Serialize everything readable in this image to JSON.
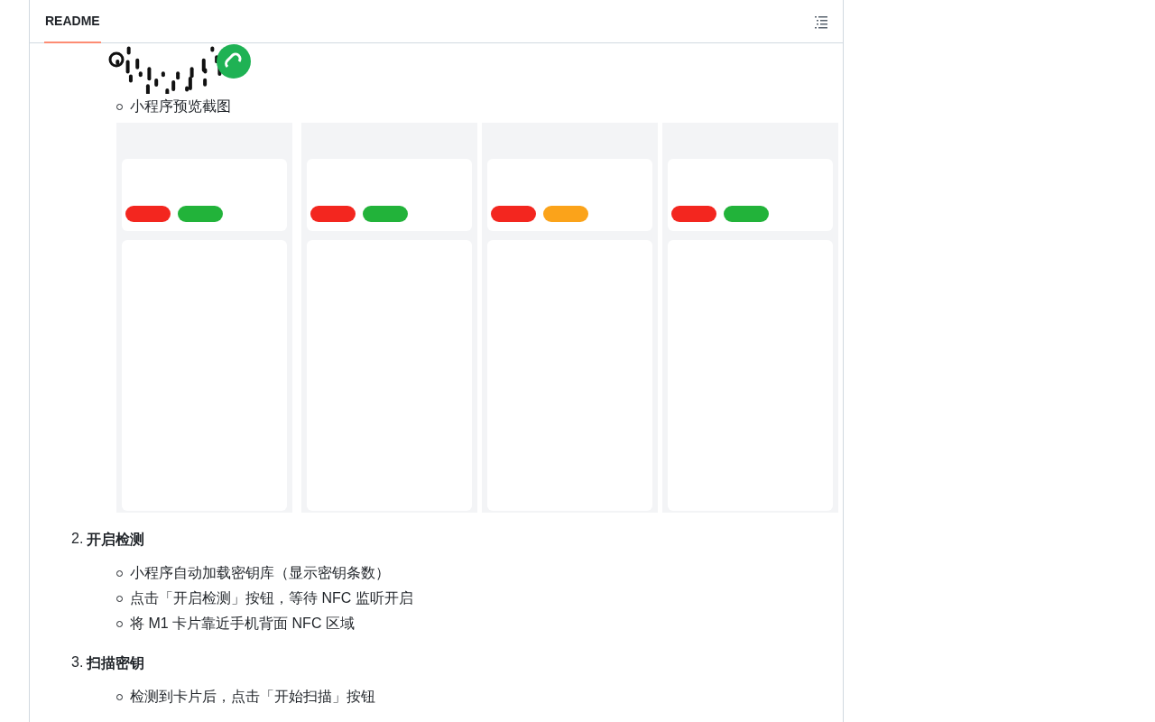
{
  "header": {
    "tabs": [
      {
        "label": "README",
        "selected": true
      }
    ]
  },
  "preview": {
    "items": [
      {
        "text": "小程序预览截图"
      }
    ]
  },
  "steps": [
    {
      "number": "2.",
      "title": "开启检测",
      "items": [
        {
          "text": "小程序自动加载密钥库（显示密钥条数）"
        },
        {
          "text": "点击「开启检测」按钮，等待 NFC 监听开启"
        },
        {
          "text": "将 M1 卡片靠近手机背面 NFC 区域"
        }
      ]
    },
    {
      "number": "3.",
      "title": "扫描密钥",
      "items": [
        {
          "text": "检测到卡片后，点击「开始扫描」按钮"
        }
      ]
    }
  ]
}
